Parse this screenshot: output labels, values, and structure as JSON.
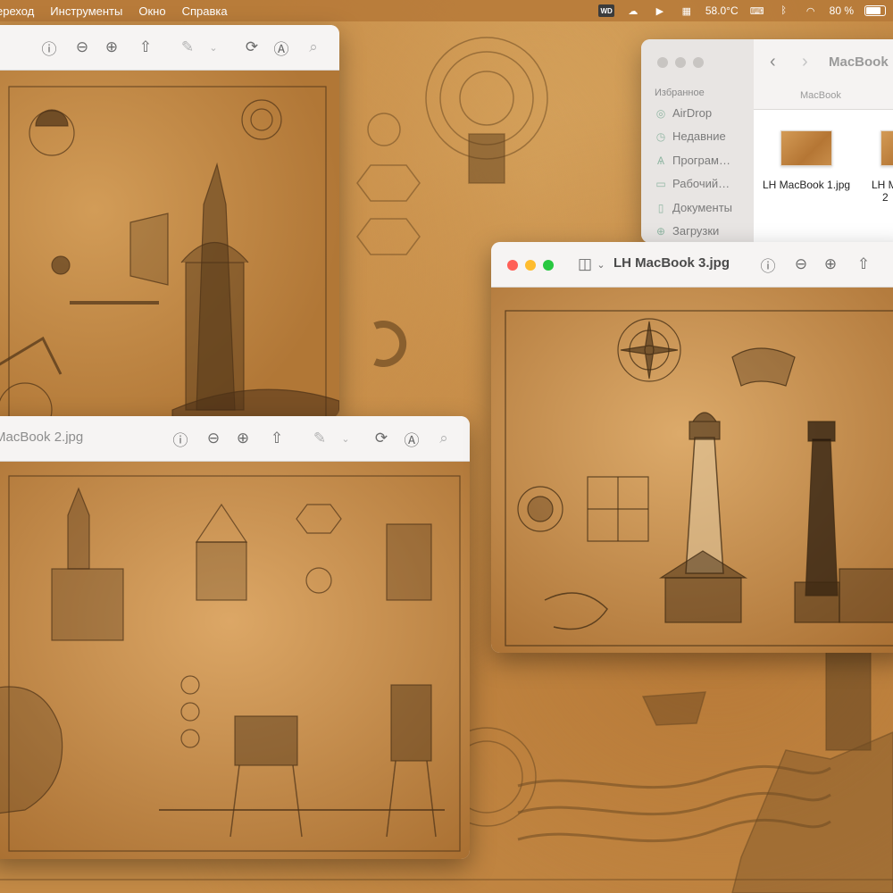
{
  "menubar": {
    "items": [
      "ереход",
      "Инструменты",
      "Окно",
      "Справка"
    ],
    "temperature": "58.0°C",
    "battery": "80 %",
    "battery_level": 0.8,
    "icons": [
      "wd-drive-icon",
      "creative-cloud-icon",
      "play-icon",
      "cpu-icon",
      "keyboard-icon",
      "bluetooth-icon",
      "wifi-icon",
      "battery-icon"
    ]
  },
  "finder": {
    "title": "MacBook",
    "path_label": "MacBook",
    "sidebar_section": "Избранное",
    "sidebar_items": [
      {
        "label": "AirDrop",
        "icon": "airdrop-icon"
      },
      {
        "label": "Недавние",
        "icon": "clock-icon"
      },
      {
        "label": "Програм…",
        "icon": "applications-icon"
      },
      {
        "label": "Рабочий…",
        "icon": "desktop-icon"
      },
      {
        "label": "Документы",
        "icon": "document-icon"
      },
      {
        "label": "Загрузки",
        "icon": "download-icon"
      }
    ],
    "files": [
      {
        "name": "LH MacBook 1.jpg"
      },
      {
        "name": "LH M",
        "name_line2": "2"
      }
    ]
  },
  "windows": {
    "w1": {
      "title": ""
    },
    "w2": {
      "title": "MacBook 2.jpg"
    },
    "w3": {
      "title": "LH MacBook 3.jpg"
    }
  },
  "colors": {
    "accent_close": "#ff5f57",
    "accent_min": "#febc2e",
    "accent_max": "#28c840",
    "parchment": "#c58b46"
  }
}
